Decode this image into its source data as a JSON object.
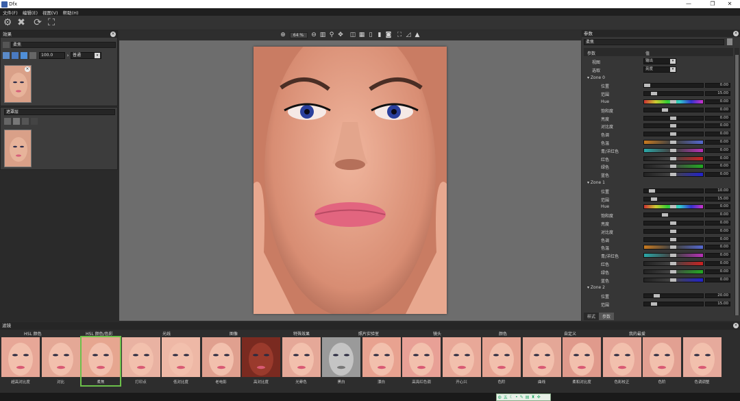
{
  "window": {
    "title": "Dfx"
  },
  "menu": [
    "文件(F)",
    "编辑(E)",
    "视图(V)",
    "帮助(H)"
  ],
  "toolbar": {
    "icons": [
      "gear-icon",
      "close-icon",
      "refresh-icon",
      "fit-icon"
    ]
  },
  "effects_panel": {
    "title": "效果",
    "layer_name": "柔焦",
    "opacity": "100.0",
    "blend_mode": "普通",
    "mask_title": "遮罩层"
  },
  "canvas": {
    "zoom": "64 %"
  },
  "params_panel": {
    "title": "参数",
    "preset_name": "柔焦",
    "col_param": "参数",
    "col_value": "值",
    "view_label": "视图",
    "view_value": "输出",
    "select_label": "选取",
    "select_value": "亮度",
    "zone0": "Zone 0",
    "zone1": "Zone 1",
    "zone2": "Zone 2",
    "zone0_rows": [
      {
        "label": "位置",
        "value": "0.00"
      },
      {
        "label": "范围",
        "value": "15.00"
      },
      {
        "label": "Hue",
        "value": "0.00"
      },
      {
        "label": "饱和度",
        "value": "0.00"
      },
      {
        "label": "亮度",
        "value": "0.00"
      },
      {
        "label": "对比度",
        "value": "0.00"
      },
      {
        "label": "色调",
        "value": "0.00"
      },
      {
        "label": "色温",
        "value": "0.00"
      },
      {
        "label": "青/洋红色",
        "value": "0.00"
      },
      {
        "label": "红色",
        "value": "0.00"
      },
      {
        "label": "绿色",
        "value": "0.00"
      },
      {
        "label": "蓝色",
        "value": "0.00"
      }
    ],
    "zone1_rows": [
      {
        "label": "位置",
        "value": "10.00"
      },
      {
        "label": "范围",
        "value": "15.00"
      },
      {
        "label": "Hue",
        "value": "0.00"
      },
      {
        "label": "饱和度",
        "value": "0.00"
      },
      {
        "label": "亮度",
        "value": "0.00"
      },
      {
        "label": "对比度",
        "value": "0.00"
      },
      {
        "label": "色调",
        "value": "0.00"
      },
      {
        "label": "色温",
        "value": "0.00"
      },
      {
        "label": "青/洋红色",
        "value": "0.00"
      },
      {
        "label": "红色",
        "value": "0.00"
      },
      {
        "label": "绿色",
        "value": "0.00"
      },
      {
        "label": "蓝色",
        "value": "0.00"
      }
    ],
    "zone2_rows": [
      {
        "label": "位置",
        "value": "20.00"
      },
      {
        "label": "范围",
        "value": "15.00"
      }
    ],
    "tab_mask": "样式",
    "tab_params": "参数"
  },
  "presets_panel": {
    "title": "滤镜",
    "categories": [
      "HSL 颜色",
      "HSL 颜色/色彩",
      "光线",
      "图像",
      "特殊效果",
      "照片实验室",
      "镜头",
      "颜色",
      "自定义",
      "我的最爱"
    ],
    "items": [
      {
        "label": "超高对比度"
      },
      {
        "label": "对比"
      },
      {
        "label": "柔焦"
      },
      {
        "label": "打印点"
      },
      {
        "label": "低对比度"
      },
      {
        "label": "老电影"
      },
      {
        "label": "高对比度"
      },
      {
        "label": "光晕色"
      },
      {
        "label": "黑白"
      },
      {
        "label": "漂白"
      },
      {
        "label": "高亮红色调"
      },
      {
        "label": "开心兴"
      },
      {
        "label": "色阶"
      },
      {
        "label": "曲线"
      },
      {
        "label": "柔和对比度"
      },
      {
        "label": "色彩校正"
      },
      {
        "label": "色阶"
      },
      {
        "label": "色调调整"
      }
    ],
    "selected_index": 2
  }
}
